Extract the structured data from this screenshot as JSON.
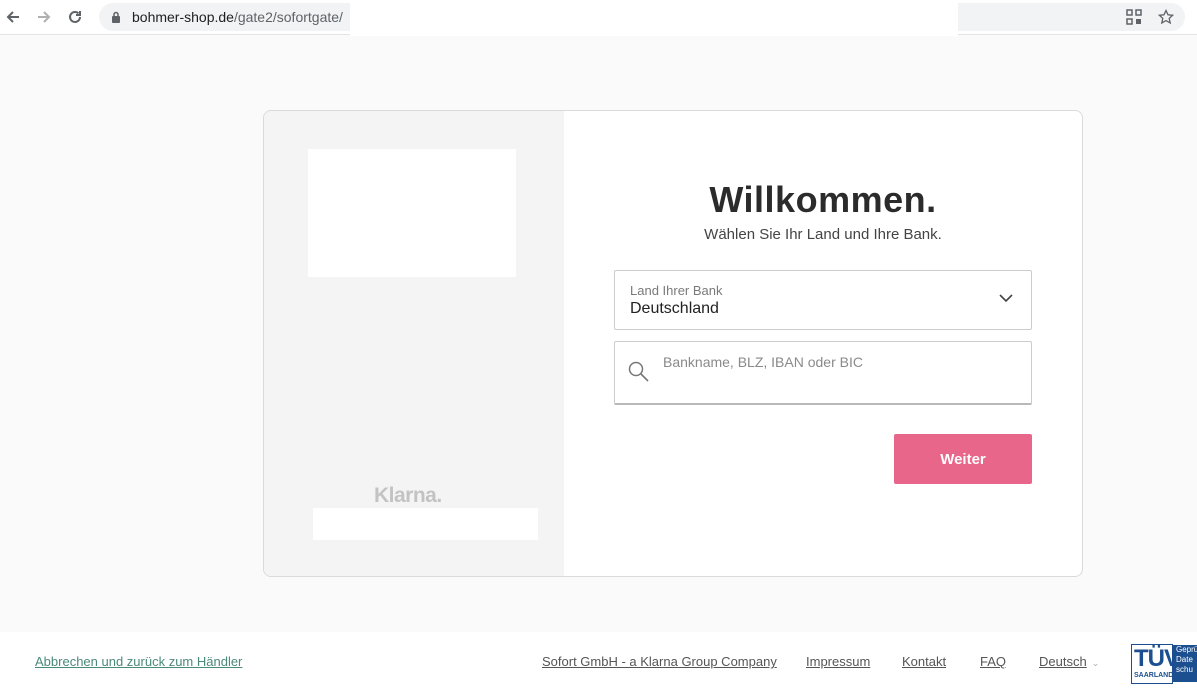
{
  "browser": {
    "url_domain": "bohmer-shop.de",
    "url_path": "/gate2/sofortgate/"
  },
  "card": {
    "brand": "Klarna.",
    "title": "Willkommen.",
    "subtitle": "Wählen Sie Ihr Land und Ihre Bank.",
    "country_select": {
      "label": "Land Ihrer Bank",
      "value": "Deutschland"
    },
    "bank_search": {
      "placeholder": "Bankname, BLZ, IBAN oder BIC",
      "value": ""
    },
    "continue_label": "Weiter"
  },
  "footer": {
    "cancel_link": "Abbrechen und zurück zum Händler",
    "company_link": "Sofort GmbH - a Klarna Group Company",
    "impressum_link": "Impressum",
    "kontakt_link": "Kontakt",
    "faq_link": "FAQ",
    "language": "Deutsch",
    "seal": {
      "brand": "TÜV",
      "region": "SAARLAND",
      "side_text": "Geprü Date schu"
    }
  },
  "colors": {
    "accent": "#e8668a",
    "link_green": "#4a8a78",
    "panel_gray": "#f4f4f4",
    "tuv_blue": "#1c4f8f"
  }
}
